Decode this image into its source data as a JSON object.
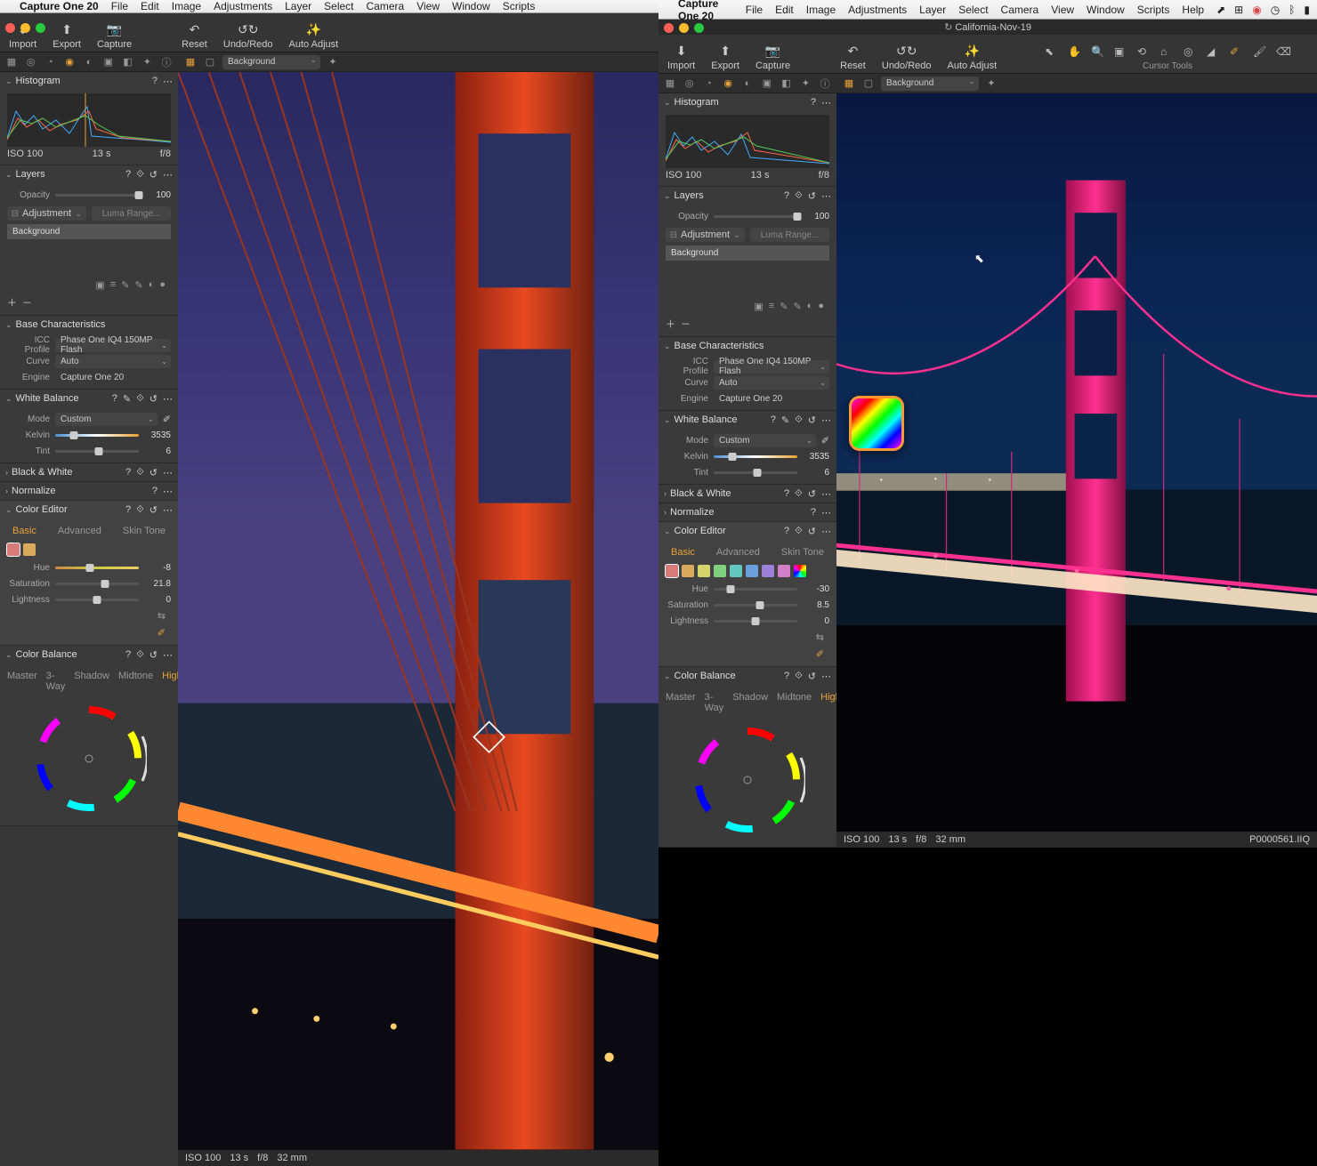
{
  "menu": {
    "apple": "",
    "app": "Capture One 20",
    "items": [
      "File",
      "Edit",
      "Image",
      "Adjustments",
      "Layer",
      "Select",
      "Camera",
      "View",
      "Window",
      "Scripts",
      "Help"
    ]
  },
  "menubar_right": {
    "clock": ""
  },
  "doc_title": "California-Nov-19",
  "toolbar": {
    "import": "Import",
    "export": "Export",
    "capture": "Capture",
    "reset": "Reset",
    "undoredo": "Undo/Redo",
    "autoadjust": "Auto Adjust",
    "cursortools": "Cursor Tools"
  },
  "viewbar": {
    "bg": "Background"
  },
  "histogram": {
    "title": "Histogram",
    "iso": "ISO 100",
    "shutter": "13 s",
    "ap": "f/8"
  },
  "layers": {
    "title": "Layers",
    "opacity": "Opacity",
    "opacity_val": "100",
    "adjustment": "Adjustment",
    "lumarange": "Luma Range...",
    "bg": "Background"
  },
  "basechar": {
    "title": "Base Characteristics",
    "icc": "ICC Profile",
    "icc_val": "Phase One IQ4 150MP Flash",
    "curve": "Curve",
    "curve_val": "Auto",
    "engine": "Engine",
    "engine_val": "Capture One 20"
  },
  "wb": {
    "title": "White Balance",
    "mode": "Mode",
    "mode_val": "Custom",
    "kelvin": "Kelvin",
    "kelvin_val": "3535",
    "tint": "Tint",
    "tint_val": "6"
  },
  "bw": {
    "title": "Black & White"
  },
  "norm": {
    "title": "Normalize"
  },
  "ce": {
    "title": "Color Editor",
    "tabs": [
      "Basic",
      "Advanced",
      "Skin Tone"
    ],
    "hue": "Hue",
    "sat": "Saturation",
    "light": "Lightness",
    "left": {
      "hue_val": "-8",
      "sat_val": "21.8",
      "light_val": "0"
    },
    "right": {
      "hue_val": "-30",
      "sat_val": "8.5",
      "light_val": "0"
    }
  },
  "cb": {
    "title": "Color Balance",
    "tabs": [
      "Master",
      "3-Way",
      "Shadow",
      "Midtone",
      "Highlight"
    ]
  },
  "status": {
    "iso": "ISO 100",
    "shutter": "13 s",
    "ap": "f/8",
    "focal": "32 mm",
    "file": "P0000561.IIQ"
  },
  "swatches_left": [
    "#d97a7a",
    "#d9a95c"
  ],
  "swatches_right": [
    "#d97a7a",
    "#d9a95c",
    "#d4d46a",
    "#7fcf7f",
    "#62c7c0",
    "#6a9fde",
    "#9b7fd9",
    "#d27fc7",
    "conic"
  ]
}
